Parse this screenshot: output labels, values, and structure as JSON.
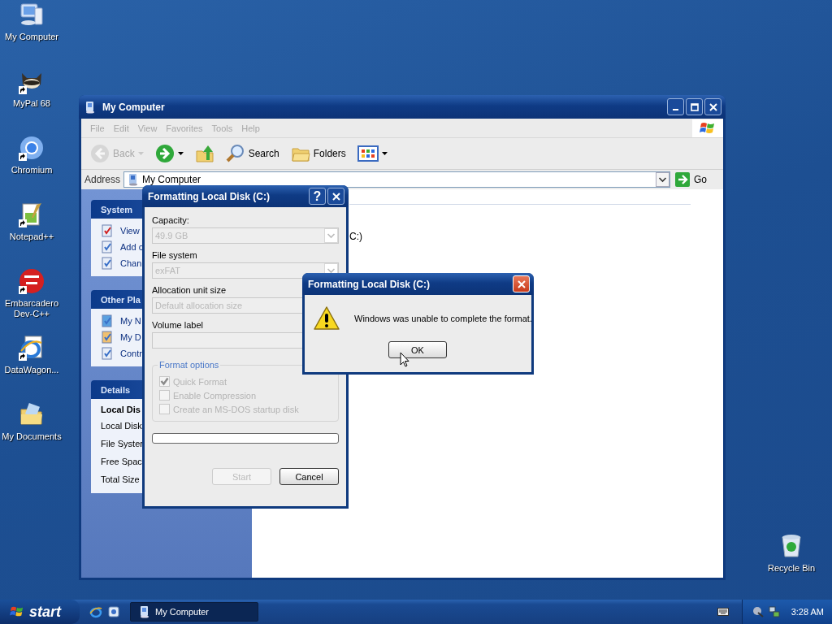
{
  "desktop_icons": [
    {
      "label": "My Computer",
      "kind": "computer",
      "shortcut": false
    },
    {
      "label": "MyPal 68",
      "kind": "animal",
      "shortcut": true
    },
    {
      "label": "Chromium",
      "kind": "ring",
      "shortcut": true
    },
    {
      "label": "Notepad++",
      "kind": "notepad",
      "shortcut": true
    },
    {
      "label": "Embarcadero Dev-C++",
      "kind": "dev",
      "shortcut": true
    },
    {
      "label": "DataWagon...",
      "kind": "ie",
      "shortcut": true
    },
    {
      "label": "My Documents",
      "kind": "docs",
      "shortcut": false
    }
  ],
  "recycle_bin": {
    "label": "Recycle Bin"
  },
  "explorer": {
    "title": "My Computer",
    "menu": [
      {
        "label": "File",
        "disabled": true
      },
      {
        "label": "Edit",
        "disabled": true
      },
      {
        "label": "View",
        "disabled": true
      },
      {
        "label": "Favorites",
        "disabled": true
      },
      {
        "label": "Tools",
        "disabled": true
      },
      {
        "label": "Help",
        "disabled": true
      }
    ],
    "toolbar": [
      {
        "kind": "back",
        "label": "Back",
        "disabled": true
      },
      {
        "kind": "forward",
        "disabled": false
      },
      {
        "kind": "up",
        "disabled": false
      },
      {
        "kind": "search",
        "label": "Search",
        "disabled": false
      },
      {
        "kind": "folders",
        "label": "Folders",
        "disabled": false
      },
      {
        "kind": "views",
        "disabled": false
      }
    ],
    "address": {
      "label": "Address",
      "value": "My Computer",
      "go": "Go"
    },
    "task_panes": [
      {
        "title": "System",
        "items": [
          {
            "kind": "info",
            "label": "View"
          },
          {
            "kind": "cd",
            "label": "Add c"
          },
          {
            "kind": "panel",
            "label": "Chan"
          }
        ]
      },
      {
        "title": "Other Pla",
        "items": [
          {
            "kind": "network",
            "label": "My N"
          },
          {
            "kind": "docs",
            "label": "My D"
          },
          {
            "kind": "panel",
            "label": "Contr"
          }
        ]
      },
      {
        "title": "Details",
        "lines": [
          {
            "text": "Local Dis",
            "bold": true
          },
          {
            "text": "Local Disk",
            "bold": false
          },
          {
            "text": "File Syster",
            "bold": false
          },
          {
            "text": "Free Spac",
            "bold": false
          },
          {
            "text": "Total Size",
            "bold": false
          }
        ]
      }
    ],
    "content": {
      "fragment": "C:)"
    }
  },
  "format_dialog": {
    "title": "Formatting Local Disk (C:)",
    "help": "?",
    "fields": [
      {
        "label": "Capacity:",
        "kind": "combo",
        "value": "49.9 GB",
        "disabled": true
      },
      {
        "label": "File system",
        "kind": "combo",
        "value": "exFAT",
        "disabled": true
      },
      {
        "label": "Allocation unit size",
        "kind": "combo",
        "value": "Default allocation size",
        "disabled": true
      },
      {
        "label": "Volume label",
        "kind": "text",
        "disabled": true
      }
    ],
    "options": {
      "title": "Format options",
      "items": [
        {
          "label": "Quick Format",
          "checked": true,
          "disabled": true
        },
        {
          "label": "Enable Compression",
          "checked": false,
          "disabled": true
        },
        {
          "label": "Create an MS-DOS startup disk",
          "checked": false,
          "disabled": true
        }
      ]
    },
    "progress": {
      "level": 0
    },
    "buttons": [
      {
        "label": "Start",
        "disabled": true
      },
      {
        "label": "Cancel",
        "disabled": false
      }
    ]
  },
  "message_box": {
    "title": "Formatting Local Disk (C:)",
    "message": "Windows was unable to complete the format.",
    "button": "OK"
  },
  "taskbar": {
    "start": "start",
    "quick_launch": [
      {
        "kind": "ie"
      },
      {
        "kind": "desktop"
      }
    ],
    "tasks": [
      {
        "label": "My Computer",
        "selected": true
      }
    ],
    "clock": "3:28 AM"
  }
}
